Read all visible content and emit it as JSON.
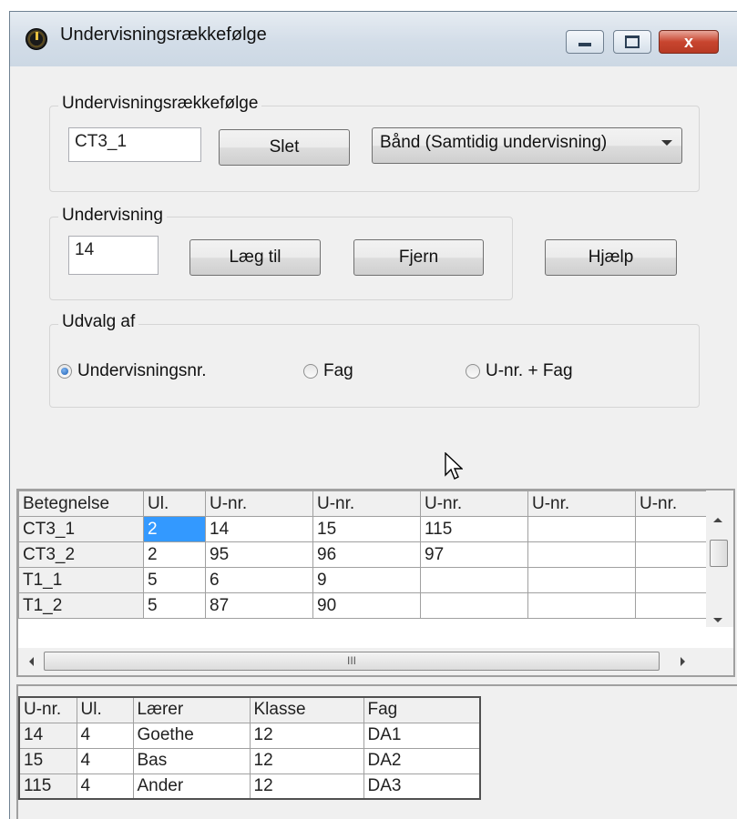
{
  "window": {
    "title": "Undervisningsrækkefølge",
    "icon": "clock-icon",
    "controls": {
      "minimize": "minimize-icon",
      "maximize": "maximize-icon",
      "close": "x"
    }
  },
  "sequence_group": {
    "title": "Undervisningsrækkefølge",
    "name_value": "CT3_1",
    "delete_label": "Slet",
    "type_selected": "Bånd (Samtidig undervisning)"
  },
  "lesson_group": {
    "title": "Undervisning",
    "number_value": "14",
    "add_label": "Læg til",
    "remove_label": "Fjern"
  },
  "help_label": "Hjælp",
  "selection_group": {
    "title": "Udvalg af",
    "options": [
      {
        "label": "Undervisningsnr.",
        "selected": true
      },
      {
        "label": "Fag",
        "selected": false
      },
      {
        "label": "U-nr. + Fag",
        "selected": false
      }
    ]
  },
  "sequence_grid": {
    "headers": [
      "Betegnelse",
      "Ul.",
      "U-nr.",
      "U-nr.",
      "U-nr.",
      "U-nr.",
      "U-nr."
    ],
    "rows": [
      [
        "CT3_1",
        "2",
        "14",
        "15",
        "115",
        "",
        ""
      ],
      [
        "CT3_2",
        "2",
        "95",
        "96",
        "97",
        "",
        ""
      ],
      [
        "T1_1",
        "5",
        "6",
        "9",
        "",
        "",
        ""
      ],
      [
        "T1_2",
        "5",
        "87",
        "90",
        "",
        "",
        ""
      ]
    ],
    "hscroll_grip": "III"
  },
  "detail_grid": {
    "headers": [
      "U-nr.",
      "Ul.",
      "Lærer",
      "Klasse",
      "Fag"
    ],
    "rows": [
      [
        "14",
        "4",
        "Goethe",
        "12",
        "DA1"
      ],
      [
        "15",
        "4",
        "Bas",
        "12",
        "DA2"
      ],
      [
        "115",
        "4",
        "Ander",
        "12",
        "DA3"
      ]
    ]
  }
}
